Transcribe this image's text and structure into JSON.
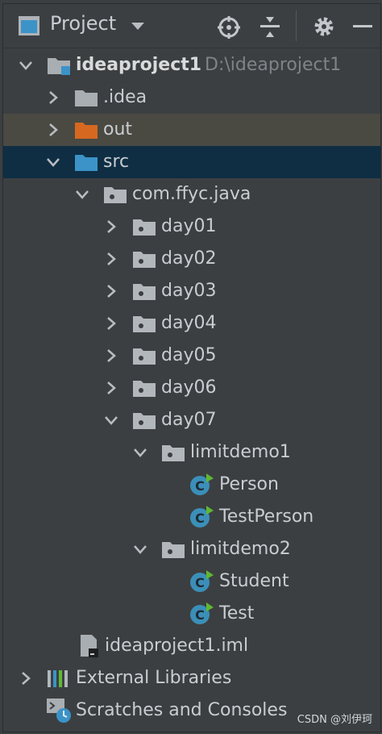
{
  "panel": {
    "title": "Project",
    "watermark": "CSDN @刘伊珂"
  },
  "tree": {
    "root": {
      "name": "ideaproject1",
      "path": "D:\\ideaproject1"
    },
    "idea": ".idea",
    "out": "out",
    "src": "src",
    "package": "com.ffyc.java",
    "days": [
      "day01",
      "day02",
      "day03",
      "day04",
      "day05",
      "day06",
      "day07"
    ],
    "limitdemo1": {
      "name": "limitdemo1",
      "classes": [
        "Person",
        "TestPerson"
      ]
    },
    "limitdemo2": {
      "name": "limitdemo2",
      "classes": [
        "Student",
        "Test"
      ]
    },
    "iml": "ideaproject1.iml",
    "external": "External Libraries",
    "scratches": "Scratches and Consoles"
  },
  "colors": {
    "selected_row": "#0f2e43",
    "out_row": "#4a4a43",
    "src_folder": "#3b93c8",
    "out_folder": "#d6691f",
    "package_folder": "#b2b7bc"
  }
}
